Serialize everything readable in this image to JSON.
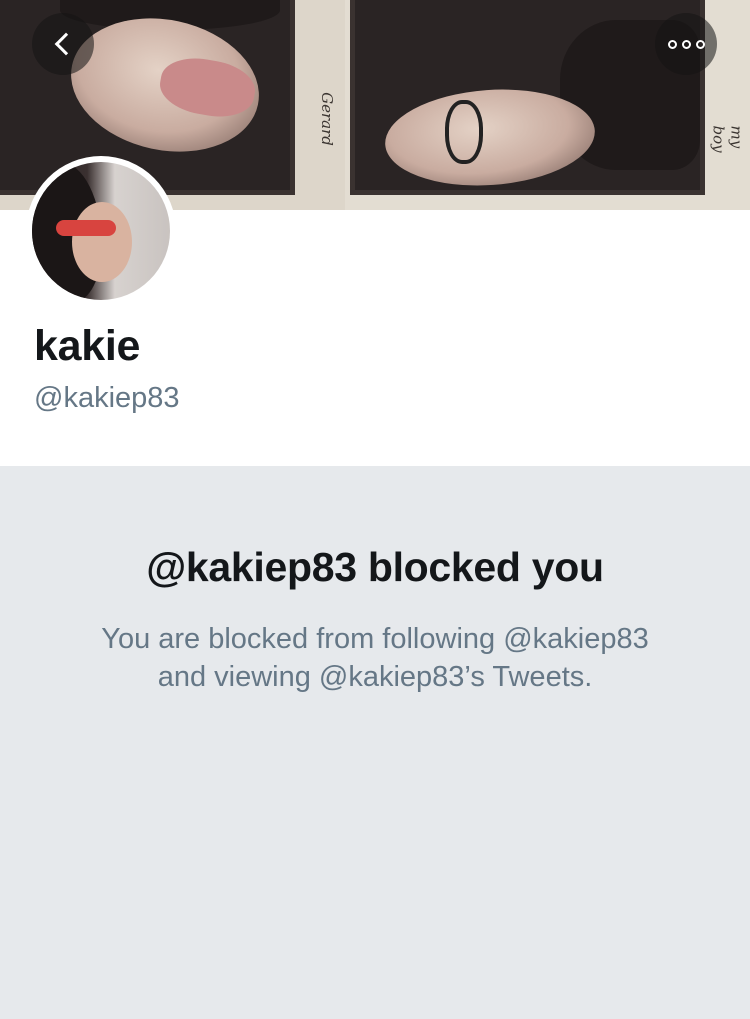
{
  "header": {
    "back_icon": "chevron-left-icon",
    "more_icon": "more-horizontal-icon",
    "banner_scribble_left": "Gerard",
    "banner_scribble_right": "my boy"
  },
  "profile": {
    "display_name": "kakie",
    "handle": "@kakiep83"
  },
  "blocked": {
    "title": "@kakiep83 blocked you",
    "description": "You are blocked from following @kakiep83 and viewing @kakiep83’s Tweets."
  },
  "colors": {
    "primary_text": "#14171a",
    "secondary_text": "#657786",
    "panel_background": "#e6e9ec"
  }
}
